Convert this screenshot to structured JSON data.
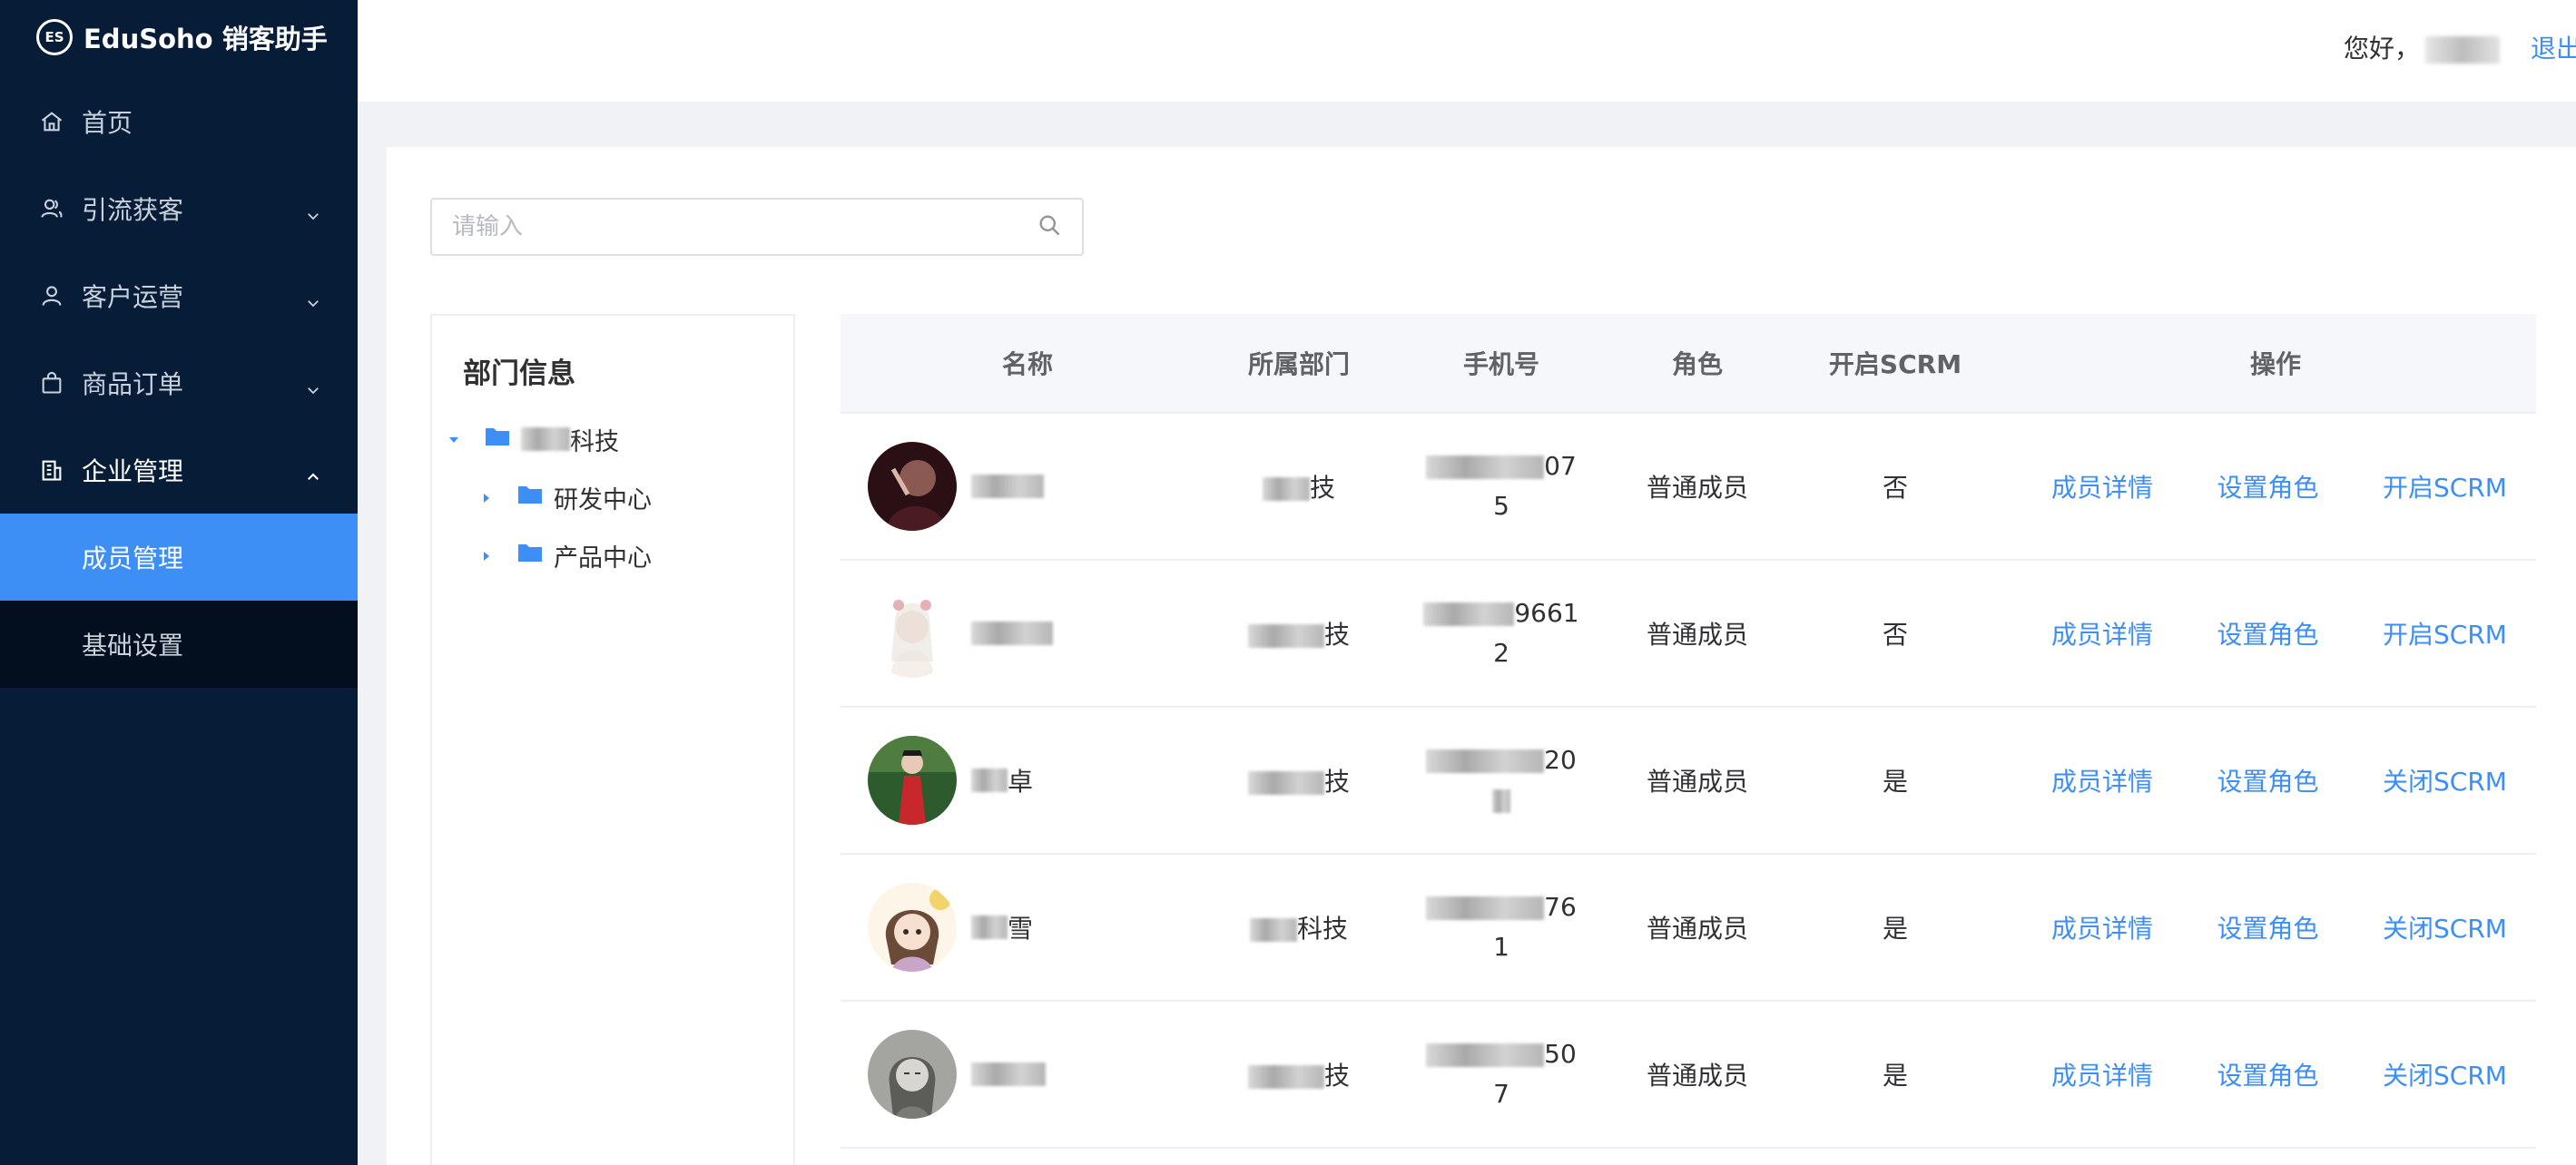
{
  "app": {
    "logo_mark": "ES",
    "title": "EduSoho 销客助手"
  },
  "menu": [
    {
      "label": "首页",
      "icon": "home-icon"
    },
    {
      "label": "引流获客",
      "icon": "users-icon"
    },
    {
      "label": "客户运营",
      "icon": "user-icon"
    },
    {
      "label": "商品订单",
      "icon": "shopping-bag-icon"
    },
    {
      "label": "企业管理",
      "icon": "building-icon"
    }
  ],
  "submenu": [
    {
      "label": "成员管理",
      "active": true
    },
    {
      "label": "基础设置",
      "active": false
    }
  ],
  "header": {
    "greeting": "您好，",
    "logout": "退出"
  },
  "search": {
    "placeholder": "请输入"
  },
  "dept_tree": {
    "title": "部门信息",
    "root_suffix": "科技",
    "children": [
      "研发中心",
      "产品中心"
    ]
  },
  "table": {
    "columns": [
      "名称",
      "所属部门",
      "手机号",
      "角色",
      "开启SCRM",
      "操作"
    ],
    "rows": [
      {
        "name_visible": "",
        "dept_visible": "技",
        "phone_line1": "07",
        "phone_line2": "5",
        "role": "普通成员",
        "scrm": "否",
        "ops": [
          "成员详情",
          "设置角色",
          "开启SCRM"
        ]
      },
      {
        "name_visible": "",
        "dept_visible": "技",
        "phone_line1": "9661",
        "phone_line2": "2",
        "role": "普通成员",
        "scrm": "否",
        "ops": [
          "成员详情",
          "设置角色",
          "开启SCRM"
        ]
      },
      {
        "name_visible": "卓",
        "dept_visible": "技",
        "phone_line1": "20",
        "phone_line2": "",
        "role": "普通成员",
        "scrm": "是",
        "ops": [
          "成员详情",
          "设置角色",
          "关闭SCRM"
        ]
      },
      {
        "name_visible": "雪",
        "dept_visible": "科技",
        "phone_line1": "76",
        "phone_line2": "1",
        "role": "普通成员",
        "scrm": "是",
        "ops": [
          "成员详情",
          "设置角色",
          "关闭SCRM"
        ]
      },
      {
        "name_visible": "",
        "dept_visible": "技",
        "phone_line1": "50",
        "phone_line2": "7",
        "role": "普通成员",
        "scrm": "是",
        "ops": [
          "成员详情",
          "设置角色",
          "关闭SCRM"
        ]
      }
    ]
  },
  "colors": {
    "sidebar_bg": "#071c36",
    "submenu_bg": "#030f1e",
    "accent": "#3d8ef5"
  }
}
